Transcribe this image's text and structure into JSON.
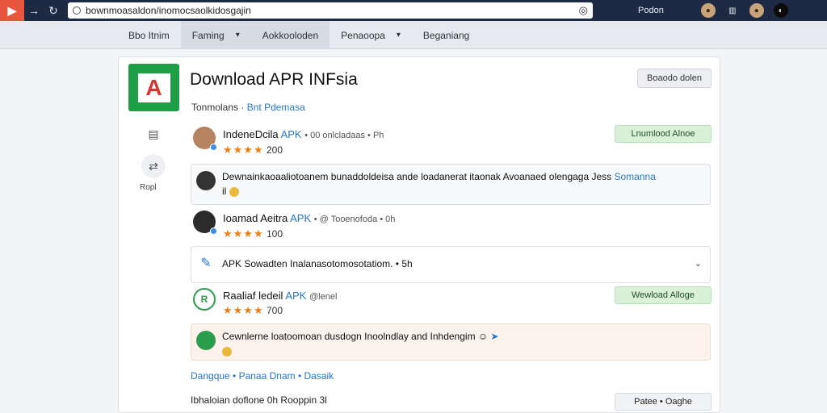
{
  "browser": {
    "url": "bownmoasaldon/inomocsaolkidosgajin",
    "menu_label": "Podon",
    "icons": [
      "app-logo-icon",
      "forward-icon",
      "refresh-icon",
      "lock-icon",
      "shield-icon",
      "avatar-icon",
      "grid-icon",
      "avatar-icon",
      "dark-mode-icon"
    ]
  },
  "tabs": [
    {
      "label": "Bbo Itnim",
      "dropdown": false,
      "active": false
    },
    {
      "label": "Faming",
      "dropdown": true,
      "active": true
    },
    {
      "label": "Aokkooloden",
      "dropdown": false,
      "active": true
    },
    {
      "label": "Penaoopa",
      "dropdown": true,
      "active": false
    },
    {
      "label": "Beganiang",
      "dropdown": false,
      "active": false
    }
  ],
  "page": {
    "title": "Download APR INFsia",
    "top_action": "Boaodo dolen",
    "meta_prefix": "Tonmolans",
    "meta_link": "Bnt Pdemasa",
    "side_label": "Ropl"
  },
  "reviews": [
    {
      "name": "IndeneDcila",
      "apk": "APK",
      "meta": "• 00 onlcladaas • Ph",
      "rating_text": "200",
      "stars": 4,
      "button": "Lnumlood Alnoe"
    },
    {
      "name": "Ioamad Aeitra",
      "apk": "APK",
      "meta": "• @ Tooenofoda • 0h",
      "rating_text": "100",
      "stars": 4,
      "button": ""
    },
    {
      "name": "Raaliaf ledeil",
      "apk": "APK",
      "meta": "@lenel",
      "rating_text": "700",
      "stars": 4,
      "button": "Wewload Alloge"
    }
  ],
  "panels": {
    "p1_text": "Dewnainkaoaaliotoanem bunaddoldeisa ande loadanerat itaonak Avoanaed olengaga Jess",
    "p1_link": "Somanna",
    "p1_text2": "il",
    "p2_text": "APK Sowadten Inalanasotomosotatiom. • 5h",
    "p3_text": "Cewnlerne loatoomoan dusdogn Inoolndlay and Inhdengim"
  },
  "footer": {
    "links": "Dangque • Panaa Dnam • Dasaik",
    "meta": "Ibhaloian doflone 0h Rooppin 3l",
    "button": "Patee • Oaghe"
  },
  "colors": {
    "accent": "#2775c8",
    "star": "#e8801a",
    "download_bg": "#d9f1d9",
    "topbar": "#1e2a44"
  }
}
